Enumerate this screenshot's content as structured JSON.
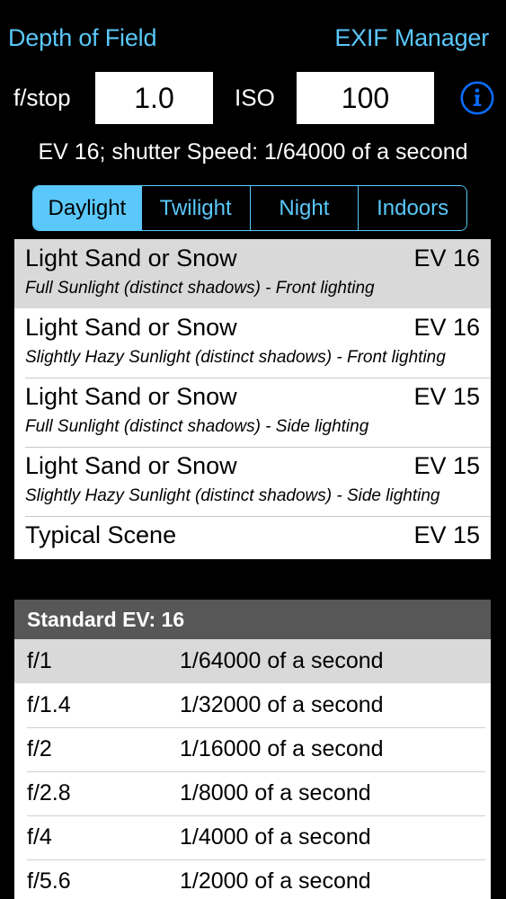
{
  "titlebar": {
    "left_title": "Depth of Field",
    "right_title": "EXIF Manager",
    "accent_color": "#5ac8fa"
  },
  "controls": {
    "fstop_label": "f/stop",
    "fstop_value": "1.0",
    "iso_label": "ISO",
    "iso_value": "100",
    "info_icon": "info-circle-icon",
    "info_color": "#0a6cff"
  },
  "summary": {
    "text": "EV 16; shutter Speed: 1/64000 of a second"
  },
  "segmented": {
    "selected_index": 0,
    "items": [
      {
        "label": "Daylight"
      },
      {
        "label": "Twilight"
      },
      {
        "label": "Night"
      },
      {
        "label": "Indoors"
      }
    ]
  },
  "scene_list": {
    "selected_index": 0,
    "rows": [
      {
        "name": "Light Sand or Snow",
        "ev": "EV 16",
        "sub": "Full Sunlight (distinct shadows) - Front lighting"
      },
      {
        "name": "Light Sand or Snow",
        "ev": "EV 16",
        "sub": "Slightly Hazy Sunlight (distinct shadows) - Front lighting"
      },
      {
        "name": "Light Sand or Snow",
        "ev": "EV 15",
        "sub": "Full Sunlight (distinct shadows) - Side lighting"
      },
      {
        "name": "Light Sand or Snow",
        "ev": "EV 15",
        "sub": "Slightly Hazy Sunlight (distinct shadows) - Side lighting"
      },
      {
        "name": "Typical Scene",
        "ev": "EV 15",
        "sub": ""
      }
    ]
  },
  "exposure_table": {
    "header": "Standard EV: 16",
    "header_bg": "#575757",
    "rows": [
      {
        "fstop": "f/1",
        "speed": "1/64000 of a second"
      },
      {
        "fstop": "f/1.4",
        "speed": "1/32000 of a second"
      },
      {
        "fstop": "f/2",
        "speed": "1/16000 of a second"
      },
      {
        "fstop": "f/2.8",
        "speed": "1/8000 of a second"
      },
      {
        "fstop": "f/4",
        "speed": "1/4000 of a second"
      },
      {
        "fstop": "f/5.6",
        "speed": "1/2000 of a second"
      }
    ]
  }
}
